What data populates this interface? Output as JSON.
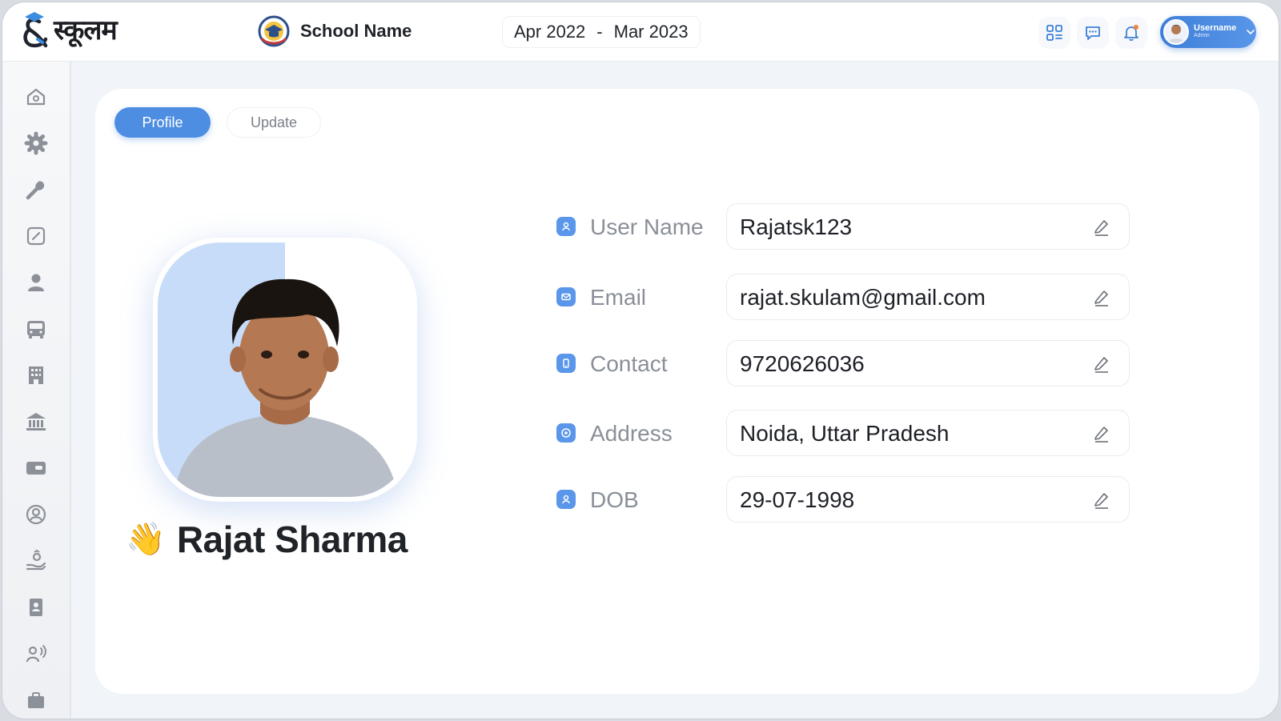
{
  "brand": {
    "logo_text": "स्कूलम"
  },
  "header": {
    "school_name": "School Name",
    "session_start": "Apr 2022",
    "session_sep": "-",
    "session_end": "Mar 2023",
    "icons": [
      "apps-grid-icon",
      "chat-icon",
      "bell-icon"
    ],
    "user": {
      "name": "Username",
      "role": "Admin"
    }
  },
  "sidebar": {
    "items": [
      {
        "icon": "home-icon"
      },
      {
        "icon": "gear-icon"
      },
      {
        "icon": "wrench-icon"
      },
      {
        "icon": "edit-note-icon"
      },
      {
        "icon": "user-icon"
      },
      {
        "icon": "bus-icon"
      },
      {
        "icon": "building-icon"
      },
      {
        "icon": "bank-icon"
      },
      {
        "icon": "id-card-icon"
      },
      {
        "icon": "user-circle-icon"
      },
      {
        "icon": "hand-donation-icon"
      },
      {
        "icon": "contact-book-icon"
      },
      {
        "icon": "announce-user-icon"
      },
      {
        "icon": "briefcase-icon"
      }
    ]
  },
  "tabs": {
    "profile": "Profile",
    "update": "Update"
  },
  "profile": {
    "wave": "👋",
    "full_name": "Rajat Sharma",
    "fields": [
      {
        "label": "User Name",
        "value": "Rajatsk123",
        "icon": "user-icon"
      },
      {
        "label": "Email",
        "value": "rajat.skulam@gmail.com",
        "icon": "mail-icon"
      },
      {
        "label": "Contact",
        "value": "9720626036",
        "icon": "phone-icon"
      },
      {
        "label": "Address",
        "value": "Noida, Uttar Pradesh",
        "icon": "location-icon"
      },
      {
        "label": "DOB",
        "value": "29-07-1998",
        "icon": "calendar-user-icon"
      }
    ]
  },
  "colors": {
    "accent": "#4d8de2",
    "field_icon": "#5a96ea",
    "background": "#f1f4f8"
  }
}
